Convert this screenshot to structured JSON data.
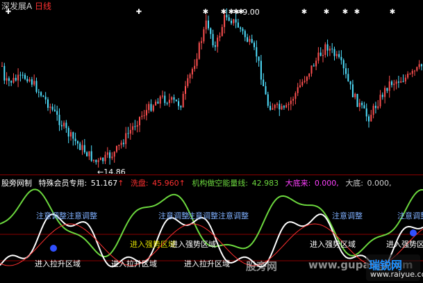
{
  "header": {
    "title": "深发展A",
    "period": "日线"
  },
  "price_labels": {
    "high": "9.00",
    "low": "14.86"
  },
  "indicator": {
    "name": "股旁网制",
    "subtitle": "特殊会员专用:",
    "val1": "51.167",
    "arrow1": "↑",
    "label2": "洗盘:",
    "val2": "45.960",
    "arrow2": "↑",
    "label3": "机构做空能量线:",
    "val3": "42.983",
    "label4": "大底来:",
    "val4": "0.000,",
    "label5": "大底:",
    "val5": "0.000,"
  },
  "annotations": {
    "attention": "注意调整",
    "enter_strong": "进入强势区域",
    "enter_pull": "进入拉升区域",
    "chaos": "注意调整注意调整"
  },
  "watermark": {
    "text": "股旁网",
    "url": "www.gupang.com"
  },
  "logo": {
    "name": "瑞锐网",
    "url": "www.raiyue.com"
  },
  "colors": {
    "up": "#ff5050",
    "down": "#50e0ff",
    "ind_white": "#ffffff",
    "ind_green": "#6cd83e",
    "ind_red": "#ff3030",
    "ind_yellow": "#e0e000",
    "ind_magenta": "#ff40ff",
    "ind_blue": "#3050ff",
    "attention_color": "#7fb0ff"
  }
}
